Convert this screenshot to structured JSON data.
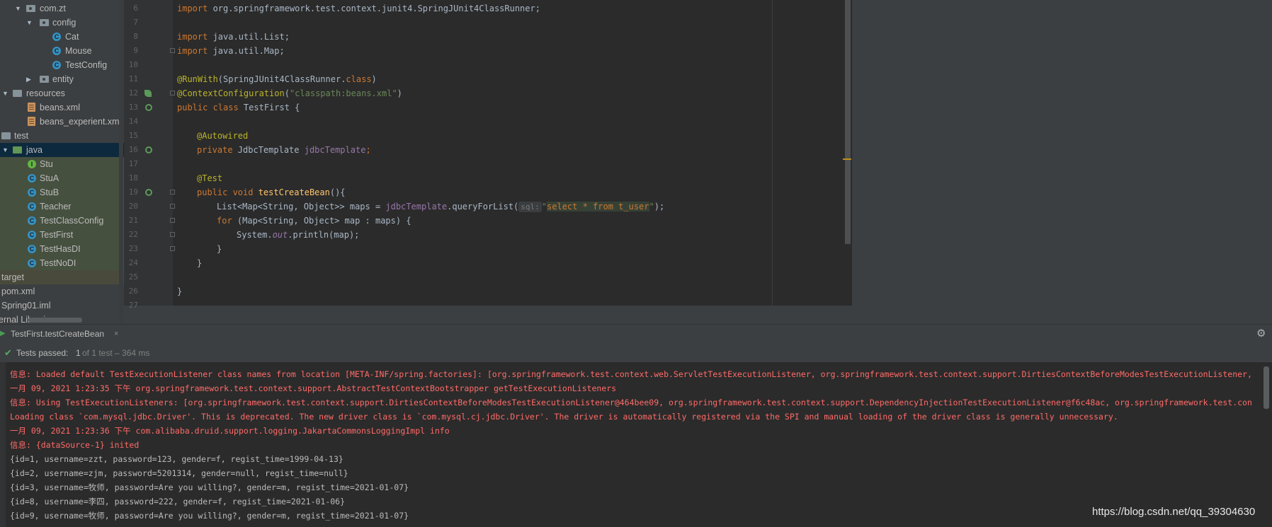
{
  "project_tree": [
    {
      "label": "com.zt",
      "kind": "package",
      "expanded": true
    },
    {
      "label": "config",
      "kind": "package",
      "expanded": true
    },
    {
      "label": "Cat",
      "kind": "class"
    },
    {
      "label": "Mouse",
      "kind": "class"
    },
    {
      "label": "TestConfig",
      "kind": "class"
    },
    {
      "label": "entity",
      "kind": "package",
      "expanded": false
    },
    {
      "label": "resources",
      "kind": "folder",
      "expanded": true
    },
    {
      "label": "beans.xml",
      "kind": "xml"
    },
    {
      "label": "beans_experient.xml",
      "kind": "xml"
    },
    {
      "label": "test",
      "kind": "folder"
    },
    {
      "label": "java",
      "kind": "folder",
      "expanded": true,
      "selected": true
    },
    {
      "label": "Stu",
      "kind": "interface"
    },
    {
      "label": "StuA",
      "kind": "class"
    },
    {
      "label": "StuB",
      "kind": "class"
    },
    {
      "label": "Teacher",
      "kind": "class"
    },
    {
      "label": "TestClassConfig",
      "kind": "class"
    },
    {
      "label": "TestFirst",
      "kind": "class"
    },
    {
      "label": "TestHasDI",
      "kind": "class"
    },
    {
      "label": "TestNoDI",
      "kind": "class"
    },
    {
      "label": "target",
      "kind": "folder"
    },
    {
      "label": "pom.xml",
      "kind": "file"
    },
    {
      "label": "Spring01.iml",
      "kind": "file"
    },
    {
      "label": "ernal Libraries",
      "kind": "library"
    }
  ],
  "editor": {
    "line_numbers": [
      "6",
      "7",
      "8",
      "9",
      "10",
      "11",
      "12",
      "13",
      "14",
      "15",
      "16",
      "17",
      "18",
      "19",
      "20",
      "21",
      "22",
      "23",
      "24",
      "25",
      "26",
      "27"
    ],
    "lines": {
      "l6": {
        "kw": "import",
        "rest": " org.springframework.test.context.junit4.SpringJUnit4ClassRunner;"
      },
      "l8": {
        "kw": "import",
        "rest": " java.util.List;"
      },
      "l9": {
        "kw": "import",
        "rest": " java.util.Map;"
      },
      "l11": {
        "anno": "@RunWith",
        "a": "(SpringJUnit4ClassRunner.",
        "kw": "class",
        "b": ")"
      },
      "l12": {
        "anno": "@ContextConfiguration",
        "a": "(",
        "str": "\"classpath:beans.xml\"",
        "b": ")"
      },
      "l13": {
        "kw": "public class",
        "rest": " TestFirst {"
      },
      "l15": {
        "anno": "@Autowired"
      },
      "l16": {
        "kw": "private",
        "a": " JdbcTemplate ",
        "fld": "jdbcTemplate",
        "b": ";"
      },
      "l18": {
        "anno": "@Test"
      },
      "l19": {
        "kw": "public void",
        "mth": " testCreateBean",
        "b": "(){"
      },
      "l20": {
        "a": "List<Map<String, Object>> maps = ",
        "fld": "jdbcTemplate",
        "b": ".queryForList(",
        "hint": "sql:",
        "q1": "\"",
        "sql": "select * from t_user",
        "q2": "\"",
        "c": ");"
      },
      "l21": {
        "kw": "for",
        "a": " (Map<String, Object> map : maps) {"
      },
      "l22": {
        "a": "System.",
        "it": "out",
        "b": ".println(map);"
      },
      "l23": {
        "a": "}"
      },
      "l24": {
        "a": "}"
      },
      "l26": {
        "a": "}"
      }
    }
  },
  "run_panel": {
    "tab_label": "TestFirst.testCreateBean",
    "close_glyph": "×",
    "gear_glyph": "⚙",
    "status_prefix": "Tests passed:",
    "status_count": "1",
    "status_rest": "of 1 test – 364 ms",
    "check_glyph": "✔"
  },
  "console_lines": [
    {
      "style": "err",
      "text": "信息: Loaded default TestExecutionListener class names from location [META-INF/spring.factories]: [org.springframework.test.context.web.ServletTestExecutionListener, org.springframework.test.context.support.DirtiesContextBeforeModesTestExecutionListener,"
    },
    {
      "style": "err",
      "text": "一月 09, 2021 1:23:35 下午 org.springframework.test.context.support.AbstractTestContextBootstrapper getTestExecutionListeners"
    },
    {
      "style": "err",
      "text": "信息: Using TestExecutionListeners: [org.springframework.test.context.support.DirtiesContextBeforeModesTestExecutionListener@464bee09, org.springframework.test.context.support.DependencyInjectionTestExecutionListener@f6c48ac, org.springframework.test.con"
    },
    {
      "style": "err",
      "text": "Loading class `com.mysql.jdbc.Driver'. This is deprecated. The new driver class is `com.mysql.cj.jdbc.Driver'. The driver is automatically registered via the SPI and manual loading of the driver class is generally unnecessary."
    },
    {
      "style": "err",
      "text": "一月 09, 2021 1:23:36 下午 com.alibaba.druid.support.logging.JakartaCommonsLoggingImpl info"
    },
    {
      "style": "err",
      "text": "信息: {dataSource-1} inited"
    },
    {
      "style": "out",
      "text": "{id=1, username=zzt, password=123, gender=f, regist_time=1999-04-13}"
    },
    {
      "style": "out",
      "text": "{id=2, username=zjm, password=5201314, gender=null, regist_time=null}"
    },
    {
      "style": "out",
      "text": "{id=3, username=牧师, password=Are you willing?, gender=m, regist_time=2021-01-07}"
    },
    {
      "style": "out",
      "text": "{id=8, username=李四, password=222, gender=f, regist_time=2021-01-06}"
    },
    {
      "style": "out",
      "text": "{id=9, username=牧师, password=Are you willing?, gender=m, regist_time=2021-01-07}"
    }
  ],
  "watermark": "https://blog.csdn.net/qq_39304630",
  "colors": {
    "keyword": "#cc7832",
    "annotation": "#bbb529",
    "string": "#6a8759",
    "field": "#9876aa",
    "method": "#ffc66d",
    "error_text": "#ff6b68",
    "success": "#59a869"
  }
}
